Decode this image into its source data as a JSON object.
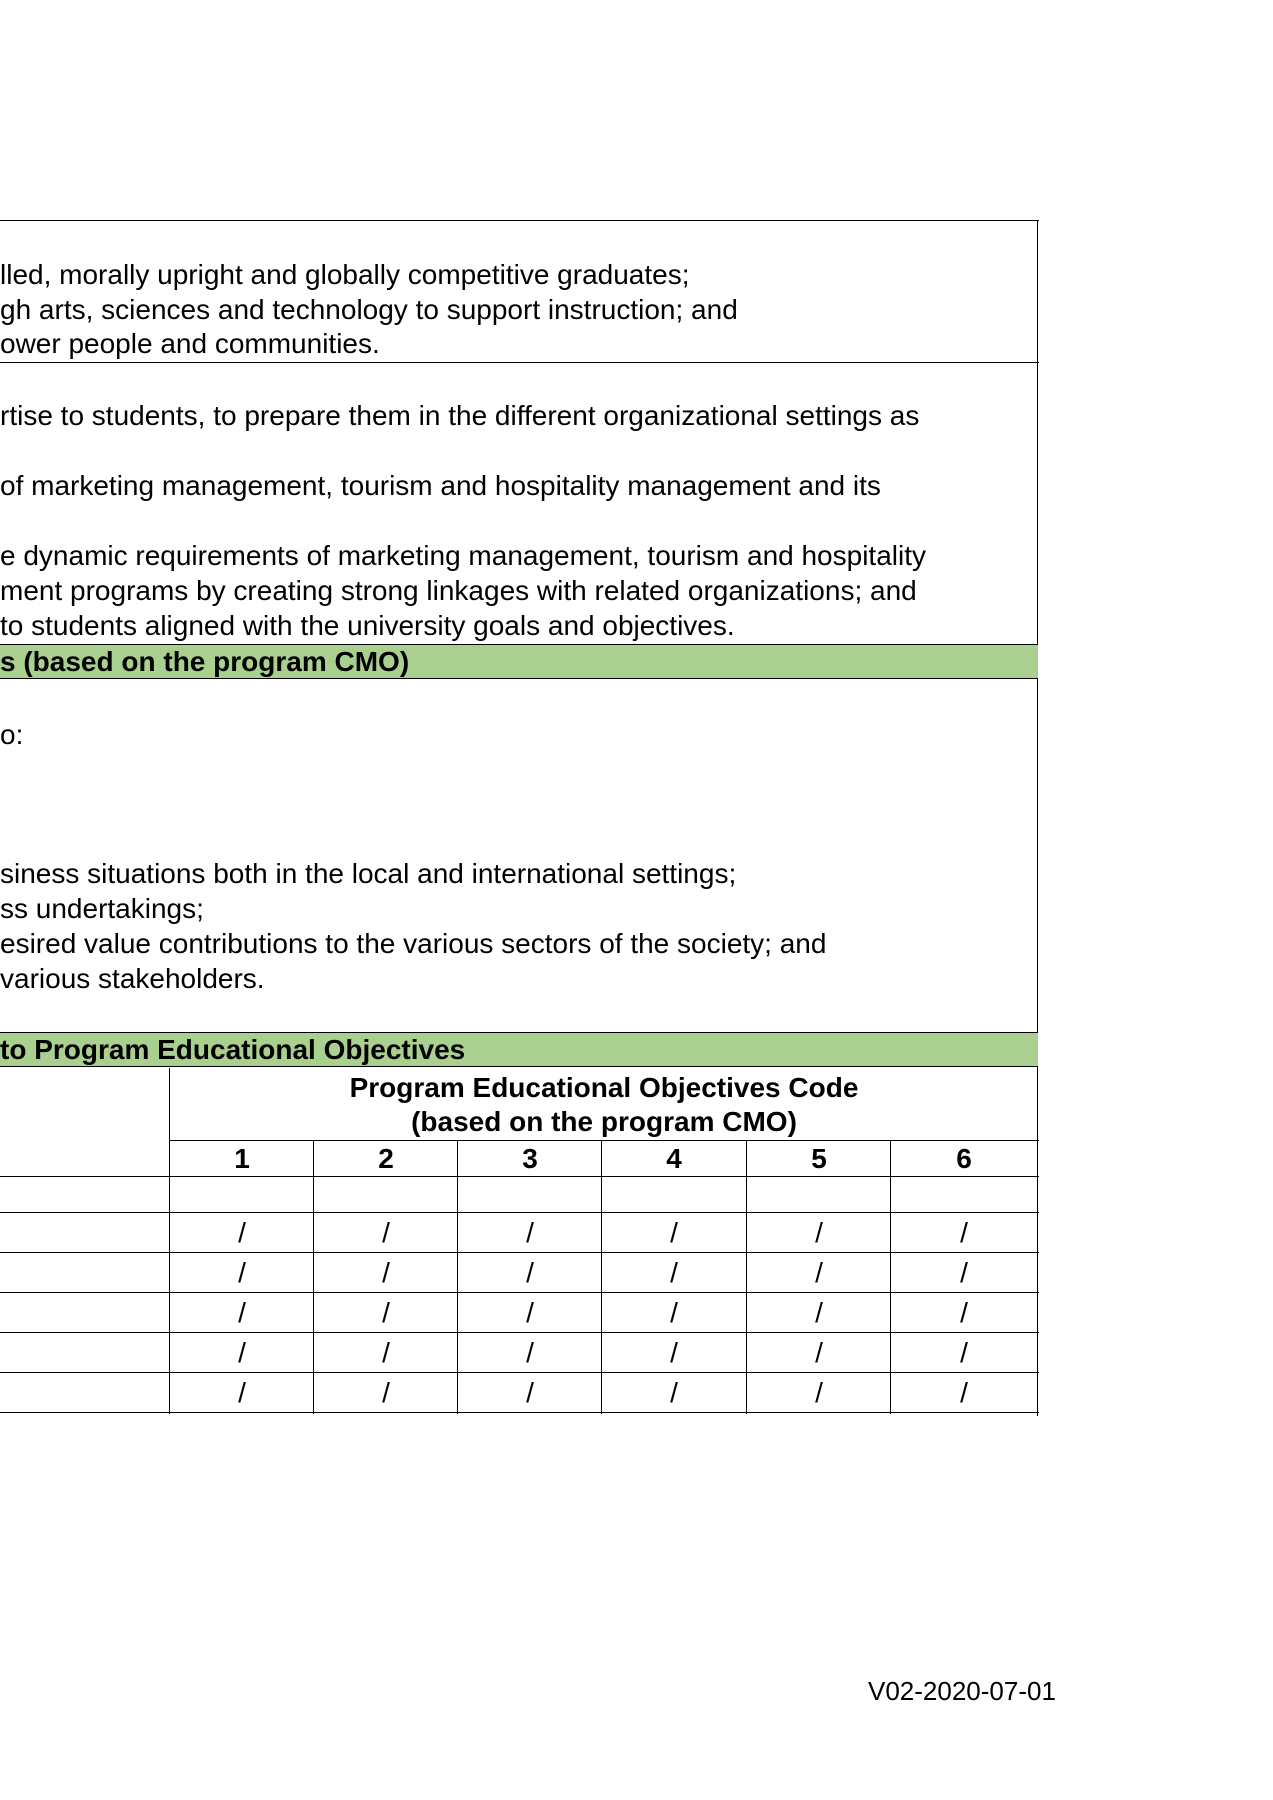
{
  "mission_lines": [
    "lled, morally upright and globally competitive graduates;",
    "gh arts, sciences and technology to support instruction; and",
    "ower people and communities."
  ],
  "objective_lines": [
    "rtise to students, to prepare them in the different organizational settings as",
    "of  marketing  management,  tourism  and  hospitality  management  and  its",
    "e dynamic requirements of marketing management, tourism and hospitality",
    "ment programs by creating strong linkages with related organizations; and",
    " to students aligned with the university goals and objectives."
  ],
  "peo_band": "s (based on the program CMO)",
  "peo_intro": "o:",
  "peo_lines": [
    "siness situations both in the local and international settings;",
    "ss undertakings;",
    "esired value contributions to the various sectors of the society; and",
    "various stakeholders."
  ],
  "mapping_band": "to Program Educational Objectives",
  "table": {
    "header_line1": "Program Educational Objectives Code",
    "header_line2": "(based on the program CMO)",
    "columns": [
      "1",
      "2",
      "3",
      "4",
      "5",
      "6"
    ],
    "rows": [
      [
        "",
        "",
        "",
        "",
        "",
        ""
      ],
      [
        "/",
        "/",
        "/",
        "/",
        "/",
        "/"
      ],
      [
        "/",
        "/",
        "/",
        "/",
        "/",
        "/"
      ],
      [
        "/",
        "/",
        "/",
        "/",
        "/",
        "/"
      ],
      [
        "/",
        "/",
        "/",
        "/",
        "/",
        "/"
      ],
      [
        "/",
        "/",
        "/",
        "/",
        "/",
        "/"
      ]
    ]
  },
  "footer": "V02-2020-07-01"
}
